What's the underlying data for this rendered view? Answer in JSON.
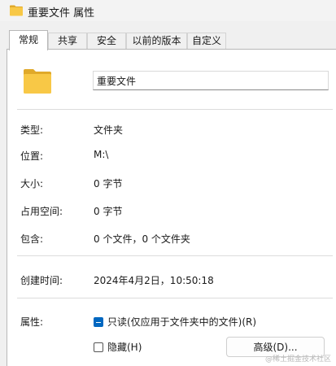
{
  "window": {
    "title": "重要文件 属性",
    "title_icon": "folder-icon"
  },
  "tabs": [
    {
      "label": "常规",
      "active": true
    },
    {
      "label": "共享",
      "active": false
    },
    {
      "label": "安全",
      "active": false
    },
    {
      "label": "以前的版本",
      "active": false
    },
    {
      "label": "自定义",
      "active": false
    }
  ],
  "general": {
    "folder_icon": "folder-icon",
    "name_value": "重要文件",
    "type_label": "类型:",
    "type_value": "文件夹",
    "location_label": "位置:",
    "location_value": "M:\\",
    "size_label": "大小:",
    "size_value": "0 字节",
    "disk_size_label": "占用空间:",
    "disk_size_value": "0 字节",
    "contains_label": "包含:",
    "contains_value": "0 个文件，0 个文件夹",
    "created_label": "创建时间:",
    "created_value": "2024年4月2日，10:50:18",
    "attributes_label": "属性:",
    "readonly_label": "只读(仅应用于文件夹中的文件)(R)",
    "readonly_state": "indeterminate",
    "hidden_label": "隐藏(H)",
    "hidden_state": "unchecked",
    "advanced_button": "高级(D)..."
  },
  "watermark": "@稀土掘金技术社区",
  "colors": {
    "folder_yellow": "#f8c846",
    "accent": "#0067c0"
  }
}
